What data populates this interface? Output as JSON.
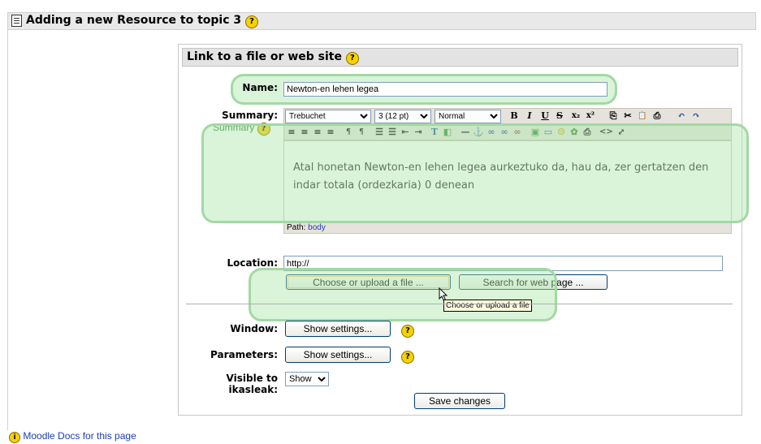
{
  "header": {
    "title": "Adding a new Resource to topic 3",
    "help_icon": "?"
  },
  "form": {
    "legend": "Link to a file or web site",
    "legend_help": "?",
    "name": {
      "label": "Name:",
      "value": "Newton-en lehen legea"
    },
    "summary": {
      "label": "Summary:",
      "help_label": "Summary",
      "help_icon": "?",
      "font_family": "Trebuchet",
      "font_size": "3 (12 pt)",
      "style": "Normal",
      "content": "Atal honetan Newton-en lehen legea aurkeztuko da, hau da, zer gertatzen den indar totala (ordezkaria) 0 denean",
      "path_label": "Path:",
      "path_value": "body",
      "toolbar_row1": [
        "B",
        "I",
        "U",
        "S",
        "x₂",
        "x²",
        "⎘",
        "✂",
        "📋",
        "⎙",
        "↶",
        "↷"
      ],
      "toolbar_row2": [
        "≡",
        "≡",
        "≡",
        "≡",
        "¶",
        "¶",
        "☰",
        "☰",
        "⇤",
        "⇥",
        "T",
        "◧",
        "—",
        "⚓",
        "∞",
        "∞",
        "∞",
        "▣",
        "▭",
        "☺",
        "✿",
        "⎙",
        "<>",
        "⤢"
      ]
    },
    "location": {
      "label": "Location:",
      "value": "http://",
      "choose_button": "Choose or upload a file ...",
      "search_button": "Search for web page ...",
      "tooltip": "Choose or upload a file"
    },
    "window": {
      "label": "Window:",
      "button": "Show settings...",
      "help_icon": "?"
    },
    "parameters": {
      "label": "Parameters:",
      "button": "Show settings...",
      "help_icon": "?"
    },
    "visible": {
      "label": "Visible to ikasleak:",
      "value": "Show"
    },
    "save_button": "Save changes"
  },
  "footer": {
    "docs_link": "Moodle Docs for this page",
    "docs_icon": "i"
  },
  "colors": {
    "highlight": "#a4d8a4",
    "link": "#1a3db7",
    "help": "#f5d200"
  }
}
